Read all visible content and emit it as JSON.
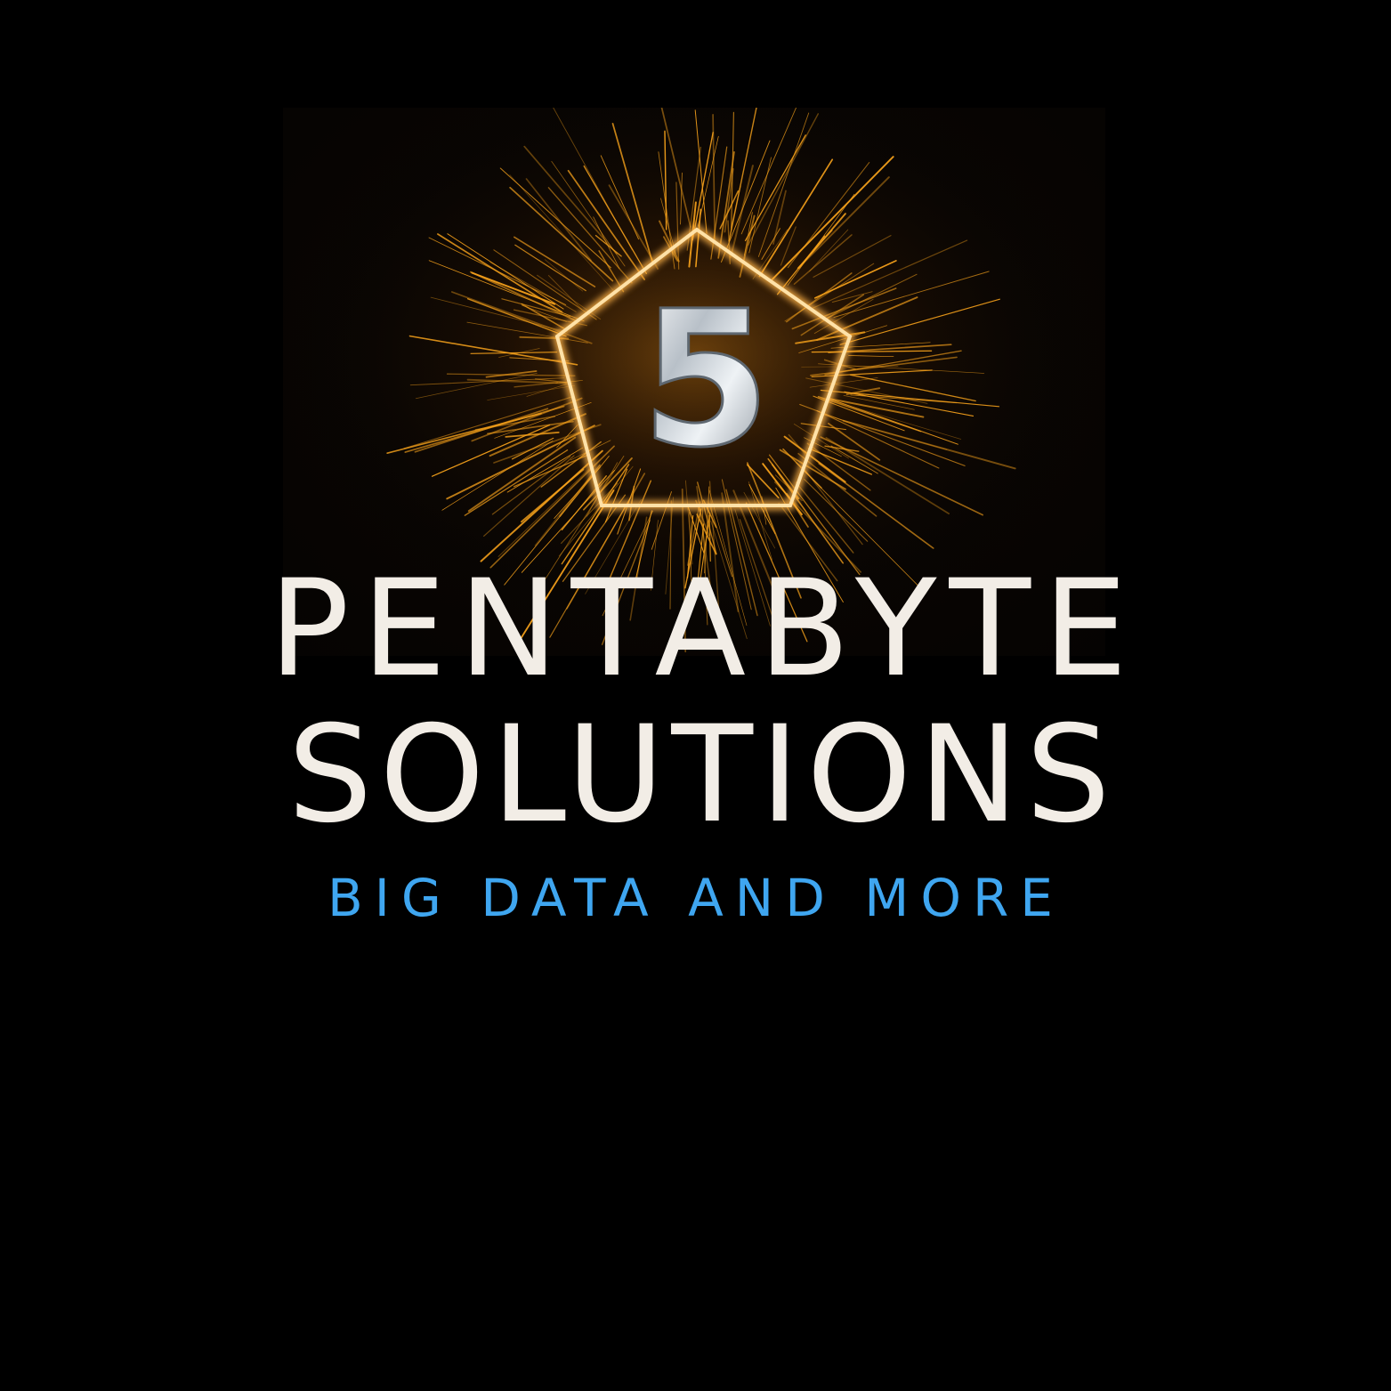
{
  "logo": {
    "emblem_numeral": "5",
    "emblem_shape": "pentagon",
    "glow_color": "#ffb347",
    "spark_color": "#f7a21b"
  },
  "brand": {
    "title_line_1": "PENTABYTE",
    "title_line_2": "SOLUTIONS",
    "tagline": "BIG DATA AND MORE",
    "title_color": "#f2ede6",
    "tagline_color": "#3fa6f0"
  },
  "background_color": "#000000"
}
